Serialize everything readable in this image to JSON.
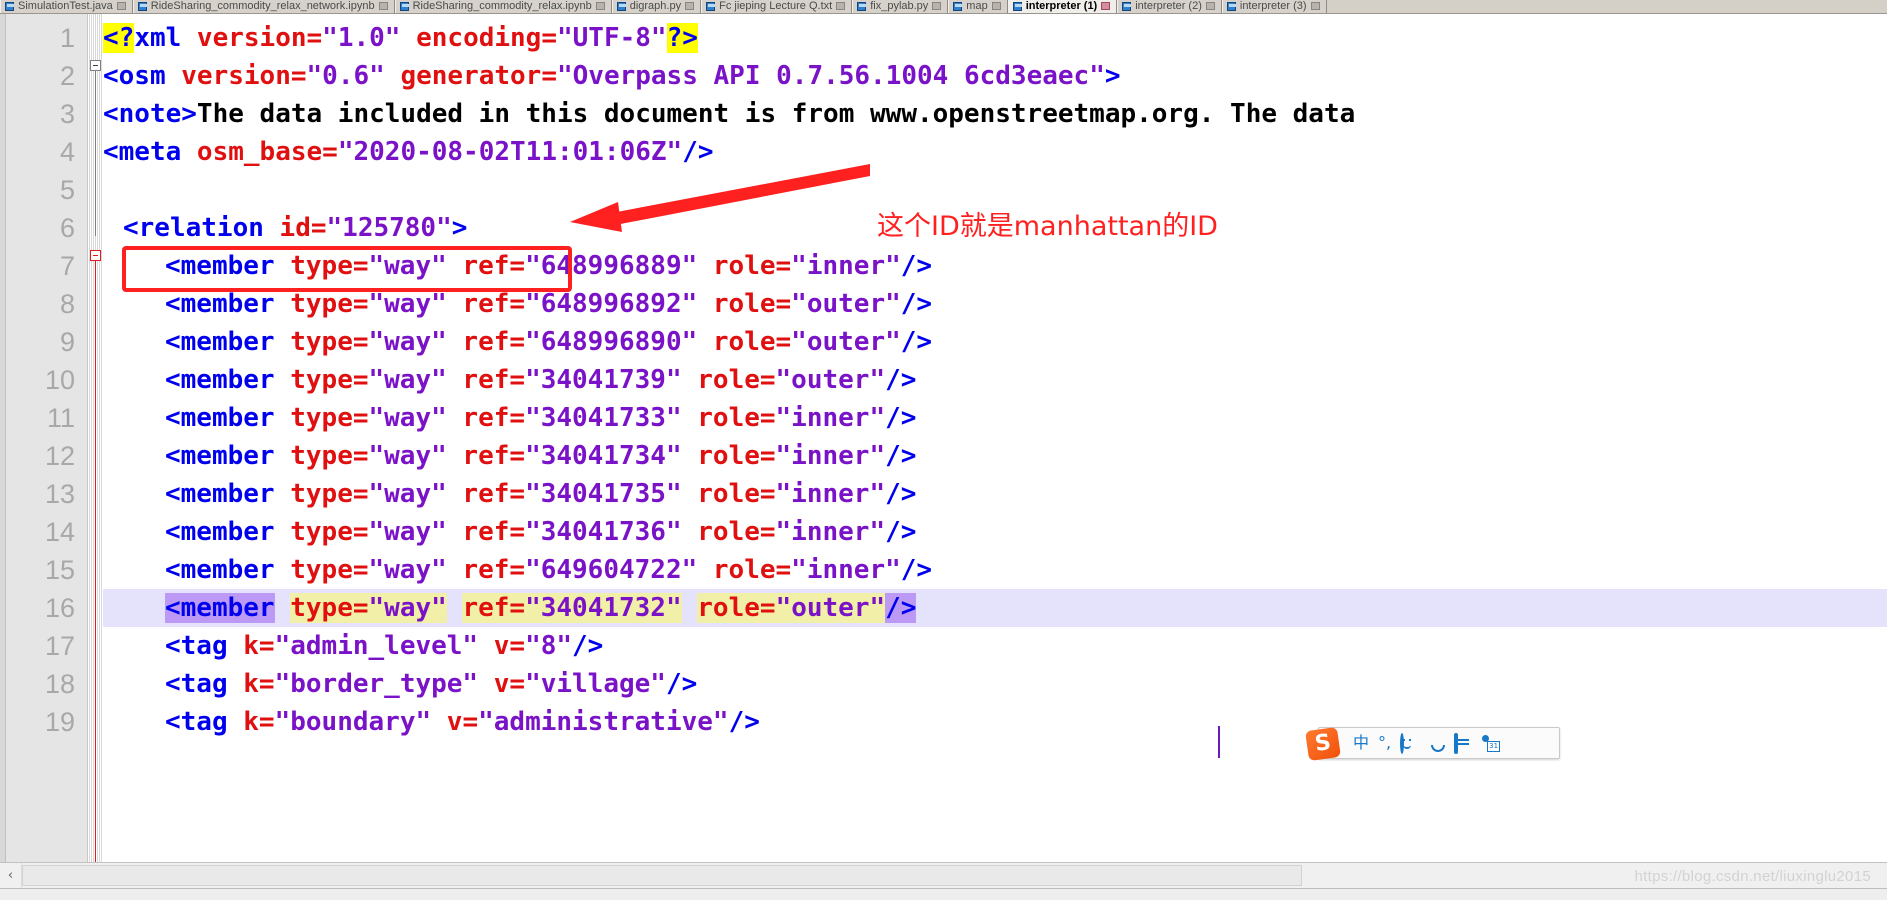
{
  "tabbar": {
    "tabs": [
      {
        "label": "SimulationTest.java",
        "active": false
      },
      {
        "label": "RideSharing_commodity_relax_network.ipynb",
        "active": false
      },
      {
        "label": "RideSharing_commodity_relax.ipynb",
        "active": false
      },
      {
        "label": "digraph.py",
        "active": false
      },
      {
        "label": "Fc jieping Lecture Q.txt",
        "active": false
      },
      {
        "label": "fix_pylab.py",
        "active": false
      },
      {
        "label": "map",
        "active": false
      },
      {
        "label": "interpreter (1)",
        "active": true
      },
      {
        "label": "interpreter (2)",
        "active": false
      },
      {
        "label": "interpreter (3)",
        "active": false
      }
    ]
  },
  "editor": {
    "line_numbers": [
      "1",
      "2",
      "3",
      "4",
      "5",
      "6",
      "7",
      "8",
      "9",
      "10",
      "11",
      "12",
      "13",
      "14",
      "15",
      "16",
      "17",
      "18",
      "19"
    ],
    "lines": [
      {
        "n": 1,
        "segments": [
          {
            "t": "<?",
            "c": "tk-tag",
            "hl": "hl-yellow"
          },
          {
            "t": "xml",
            "c": "tk-tag"
          },
          {
            "t": " version=",
            "c": "tk-attr"
          },
          {
            "t": "\"1.0\"",
            "c": "tk-val"
          },
          {
            "t": " encoding=",
            "c": "tk-attr"
          },
          {
            "t": "\"UTF-8\"",
            "c": "tk-val"
          },
          {
            "t": "?>",
            "c": "tk-tag",
            "hl": "hl-yellow"
          }
        ]
      },
      {
        "n": 2,
        "segments": [
          {
            "t": "<osm",
            "c": "tk-tag"
          },
          {
            "t": " version=",
            "c": "tk-attr"
          },
          {
            "t": "\"0.6\"",
            "c": "tk-val"
          },
          {
            "t": " generator=",
            "c": "tk-attr"
          },
          {
            "t": "\"Overpass API 0.7.56.1004 6cd3eaec\"",
            "c": "tk-val"
          },
          {
            "t": ">",
            "c": "tk-tag"
          }
        ]
      },
      {
        "n": 3,
        "segments": [
          {
            "t": "<note>",
            "c": "tk-tag"
          },
          {
            "t": "The data included in this document is from www.openstreetmap.org. The data",
            "c": "tk-text"
          }
        ]
      },
      {
        "n": 4,
        "segments": [
          {
            "t": "<meta",
            "c": "tk-tag"
          },
          {
            "t": " osm_base=",
            "c": "tk-attr"
          },
          {
            "t": "\"2020-08-02T11:01:06Z\"",
            "c": "tk-val"
          },
          {
            "t": "/>",
            "c": "tk-tag"
          }
        ]
      },
      {
        "n": 5,
        "segments": []
      },
      {
        "n": 6,
        "indent": 1,
        "segments": [
          {
            "t": "<relation",
            "c": "tk-tag"
          },
          {
            "t": " id=",
            "c": "tk-attr"
          },
          {
            "t": "\"125780\"",
            "c": "tk-val"
          },
          {
            "t": ">",
            "c": "tk-tag"
          }
        ]
      },
      {
        "n": 7,
        "indent": 2,
        "segments": [
          {
            "t": "<member",
            "c": "tk-tag"
          },
          {
            "t": " type=",
            "c": "tk-attr"
          },
          {
            "t": "\"way\"",
            "c": "tk-val"
          },
          {
            "t": " ref=",
            "c": "tk-attr"
          },
          {
            "t": "\"648996889\"",
            "c": "tk-val"
          },
          {
            "t": " role=",
            "c": "tk-attr"
          },
          {
            "t": "\"inner\"",
            "c": "tk-val"
          },
          {
            "t": "/>",
            "c": "tk-tag"
          }
        ]
      },
      {
        "n": 8,
        "indent": 2,
        "segments": [
          {
            "t": "<member",
            "c": "tk-tag"
          },
          {
            "t": " type=",
            "c": "tk-attr"
          },
          {
            "t": "\"way\"",
            "c": "tk-val"
          },
          {
            "t": " ref=",
            "c": "tk-attr"
          },
          {
            "t": "\"648996892\"",
            "c": "tk-val"
          },
          {
            "t": " role=",
            "c": "tk-attr"
          },
          {
            "t": "\"outer\"",
            "c": "tk-val"
          },
          {
            "t": "/>",
            "c": "tk-tag"
          }
        ]
      },
      {
        "n": 9,
        "indent": 2,
        "segments": [
          {
            "t": "<member",
            "c": "tk-tag"
          },
          {
            "t": " type=",
            "c": "tk-attr"
          },
          {
            "t": "\"way\"",
            "c": "tk-val"
          },
          {
            "t": " ref=",
            "c": "tk-attr"
          },
          {
            "t": "\"648996890\"",
            "c": "tk-val"
          },
          {
            "t": " role=",
            "c": "tk-attr"
          },
          {
            "t": "\"outer\"",
            "c": "tk-val"
          },
          {
            "t": "/>",
            "c": "tk-tag"
          }
        ]
      },
      {
        "n": 10,
        "indent": 2,
        "segments": [
          {
            "t": "<member",
            "c": "tk-tag"
          },
          {
            "t": " type=",
            "c": "tk-attr"
          },
          {
            "t": "\"way\"",
            "c": "tk-val"
          },
          {
            "t": " ref=",
            "c": "tk-attr"
          },
          {
            "t": "\"34041739\"",
            "c": "tk-val"
          },
          {
            "t": " role=",
            "c": "tk-attr"
          },
          {
            "t": "\"outer\"",
            "c": "tk-val"
          },
          {
            "t": "/>",
            "c": "tk-tag"
          }
        ]
      },
      {
        "n": 11,
        "indent": 2,
        "segments": [
          {
            "t": "<member",
            "c": "tk-tag"
          },
          {
            "t": " type=",
            "c": "tk-attr"
          },
          {
            "t": "\"way\"",
            "c": "tk-val"
          },
          {
            "t": " ref=",
            "c": "tk-attr"
          },
          {
            "t": "\"34041733\"",
            "c": "tk-val"
          },
          {
            "t": " role=",
            "c": "tk-attr"
          },
          {
            "t": "\"inner\"",
            "c": "tk-val"
          },
          {
            "t": "/>",
            "c": "tk-tag"
          }
        ]
      },
      {
        "n": 12,
        "indent": 2,
        "segments": [
          {
            "t": "<member",
            "c": "tk-tag"
          },
          {
            "t": " type=",
            "c": "tk-attr"
          },
          {
            "t": "\"way\"",
            "c": "tk-val"
          },
          {
            "t": " ref=",
            "c": "tk-attr"
          },
          {
            "t": "\"34041734\"",
            "c": "tk-val"
          },
          {
            "t": " role=",
            "c": "tk-attr"
          },
          {
            "t": "\"inner\"",
            "c": "tk-val"
          },
          {
            "t": "/>",
            "c": "tk-tag"
          }
        ]
      },
      {
        "n": 13,
        "indent": 2,
        "segments": [
          {
            "t": "<member",
            "c": "tk-tag"
          },
          {
            "t": " type=",
            "c": "tk-attr"
          },
          {
            "t": "\"way\"",
            "c": "tk-val"
          },
          {
            "t": " ref=",
            "c": "tk-attr"
          },
          {
            "t": "\"34041735\"",
            "c": "tk-val"
          },
          {
            "t": " role=",
            "c": "tk-attr"
          },
          {
            "t": "\"inner\"",
            "c": "tk-val"
          },
          {
            "t": "/>",
            "c": "tk-tag"
          }
        ]
      },
      {
        "n": 14,
        "indent": 2,
        "segments": [
          {
            "t": "<member",
            "c": "tk-tag"
          },
          {
            "t": " type=",
            "c": "tk-attr"
          },
          {
            "t": "\"way\"",
            "c": "tk-val"
          },
          {
            "t": " ref=",
            "c": "tk-attr"
          },
          {
            "t": "\"34041736\"",
            "c": "tk-val"
          },
          {
            "t": " role=",
            "c": "tk-attr"
          },
          {
            "t": "\"inner\"",
            "c": "tk-val"
          },
          {
            "t": "/>",
            "c": "tk-tag"
          }
        ]
      },
      {
        "n": 15,
        "indent": 2,
        "segments": [
          {
            "t": "<member",
            "c": "tk-tag"
          },
          {
            "t": " type=",
            "c": "tk-attr"
          },
          {
            "t": "\"way\"",
            "c": "tk-val"
          },
          {
            "t": " ref=",
            "c": "tk-attr"
          },
          {
            "t": "\"649604722\"",
            "c": "tk-val"
          },
          {
            "t": " role=",
            "c": "tk-attr"
          },
          {
            "t": "\"inner\"",
            "c": "tk-val"
          },
          {
            "t": "/>",
            "c": "tk-tag"
          }
        ]
      },
      {
        "n": 16,
        "indent": 2,
        "current": true,
        "segments": [
          {
            "t": "<member",
            "c": "tk-tag",
            "hl": "sel-purple"
          },
          {
            "t": " ",
            "c": "tk-attr"
          },
          {
            "t": "type=",
            "c": "tk-attr",
            "hl": "sel-yellow"
          },
          {
            "t": "\"way\"",
            "c": "tk-val",
            "hl": "sel-yellow"
          },
          {
            "t": " ",
            "c": "tk-attr"
          },
          {
            "t": "ref=",
            "c": "tk-attr",
            "hl": "sel-yellow"
          },
          {
            "t": "\"34041732\"",
            "c": "tk-val",
            "hl": "sel-yellow"
          },
          {
            "t": " ",
            "c": "tk-attr"
          },
          {
            "t": "role=",
            "c": "tk-attr",
            "hl": "sel-yellow"
          },
          {
            "t": "\"outer\"",
            "c": "tk-val",
            "hl": "sel-yellow"
          },
          {
            "t": "/>",
            "c": "tk-tag",
            "hl": "sel-purple"
          }
        ]
      },
      {
        "n": 17,
        "indent": 2,
        "segments": [
          {
            "t": "<tag",
            "c": "tk-tag"
          },
          {
            "t": " k=",
            "c": "tk-attr"
          },
          {
            "t": "\"admin_level\"",
            "c": "tk-val"
          },
          {
            "t": " v=",
            "c": "tk-attr"
          },
          {
            "t": "\"8\"",
            "c": "tk-val"
          },
          {
            "t": "/>",
            "c": "tk-tag"
          }
        ]
      },
      {
        "n": 18,
        "indent": 2,
        "segments": [
          {
            "t": "<tag",
            "c": "tk-tag"
          },
          {
            "t": " k=",
            "c": "tk-attr"
          },
          {
            "t": "\"border_type\"",
            "c": "tk-val"
          },
          {
            "t": " v=",
            "c": "tk-attr"
          },
          {
            "t": "\"village\"",
            "c": "tk-val"
          },
          {
            "t": "/>",
            "c": "tk-tag"
          }
        ]
      },
      {
        "n": 19,
        "indent": 2,
        "segments": [
          {
            "t": "<tag",
            "c": "tk-tag"
          },
          {
            "t": " k=",
            "c": "tk-attr"
          },
          {
            "t": "\"boundary\"",
            "c": "tk-val"
          },
          {
            "t": " v=",
            "c": "tk-attr"
          },
          {
            "t": "\"administrative\"",
            "c": "tk-val"
          },
          {
            "t": "/>",
            "c": "tk-tag"
          }
        ]
      }
    ]
  },
  "annotation": {
    "note_text": "这个ID就是manhattan的ID",
    "box_color": "#ff2020",
    "arrow_color": "#ff2020"
  },
  "ime": {
    "logo_text": "S",
    "items": [
      {
        "name": "language-mode",
        "glyph": "中"
      },
      {
        "name": "punctuation-mode",
        "glyph": "°,"
      }
    ],
    "icons": [
      "smiley-icon",
      "microphone-icon",
      "keyboard-icon",
      "calendar-person-icon",
      "skin-shirt-icon",
      "toolbox-grid-icon"
    ]
  },
  "scrollbar": {
    "left_arrow": "‹",
    "right_arrow": "›"
  },
  "watermark": {
    "text": "https://blog.csdn.net/liuxinglu2015"
  }
}
